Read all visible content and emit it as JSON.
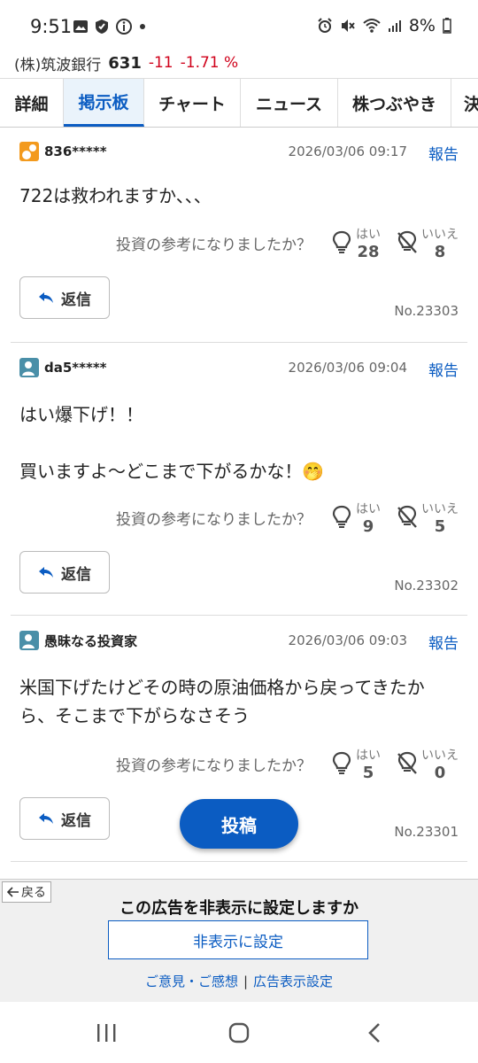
{
  "status": {
    "time": "9:51",
    "battery": "8%"
  },
  "stock": {
    "name": "(株)筑波銀行",
    "price": "631",
    "change": "-11",
    "change_pct": "-1.71 %",
    "neg_color": "#d0021b"
  },
  "tabs": [
    {
      "label": "詳細"
    },
    {
      "label": "掲示板"
    },
    {
      "label": "チャート"
    },
    {
      "label": "ニュース"
    },
    {
      "label": "株つぶやき"
    },
    {
      "label": "決"
    }
  ],
  "vote_question": "投資の参考になりましたか？",
  "vote_yes_label": "はい",
  "vote_no_label": "いいえ",
  "reply_label": "返信",
  "report_label": "報告",
  "posts": [
    {
      "user": "836*****",
      "date": "2026/03/06 09:17",
      "lines": [
        "722は救われますか、、、"
      ],
      "yes": "28",
      "no": "8",
      "number": "No.23303"
    },
    {
      "user": "da5*****",
      "date": "2026/03/06 09:04",
      "lines": [
        "はい爆下げ！！",
        "",
        "買いますよ～どこまで下がるかな！🤭"
      ],
      "yes": "9",
      "no": "5",
      "number": "No.23302"
    },
    {
      "user": "愚昧なる投資家",
      "date": "2026/03/06 09:03",
      "lines": [
        "米国下げたけどその時の原油価格から戻ってきたか",
        "ら、そこまで下がらなさそう"
      ],
      "yes": "5",
      "no": "0",
      "number": "No.23301"
    }
  ],
  "post_button": "投稿",
  "ad": {
    "back": "戻る",
    "title": "この広告を非表示に設定しますか",
    "hide_button": "非表示に設定",
    "link1": "ご意見・ご感想",
    "link2": "広告表示設定"
  },
  "colors": {
    "accent": "#0b5cc2",
    "avatar_orange": "#f39a1d",
    "avatar_teal": "#4a8fa8"
  },
  "icons": [
    "image-icon",
    "shield-icon",
    "info-icon",
    "alarm-icon",
    "mute-icon",
    "wifi-icon",
    "signal-icon",
    "battery-icon",
    "bulb-icon",
    "bulb-off-icon",
    "reply-arrow-icon",
    "back-arrow-icon",
    "recents-icon",
    "home-icon",
    "back-icon"
  ]
}
